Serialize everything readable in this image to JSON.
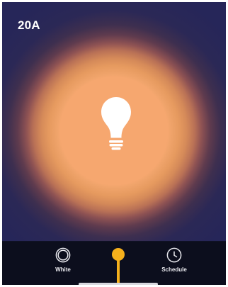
{
  "device": {
    "name": "20A"
  },
  "main": {
    "bulb_icon": "light-bulb-icon",
    "glow_color": "#f6a76f"
  },
  "bottom_nav": {
    "white": {
      "label": "White",
      "icon": "white-circle-icon"
    },
    "schedule": {
      "label": "Schedule",
      "icon": "clock-icon"
    }
  },
  "brightness_slider": {
    "color": "#f6b01c"
  }
}
